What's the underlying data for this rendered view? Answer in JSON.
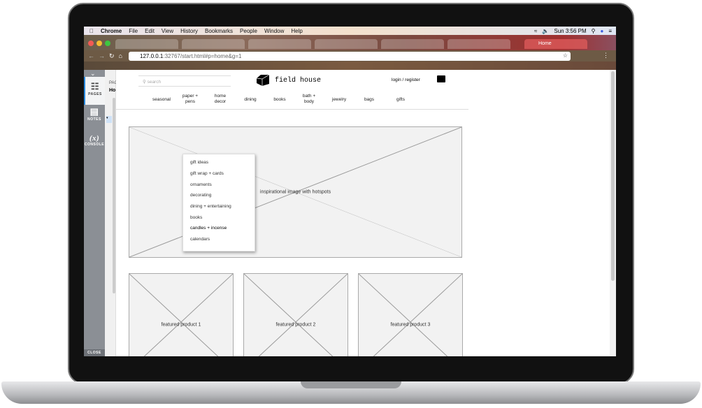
{
  "menubar": {
    "app": "Chrome",
    "items": [
      "File",
      "Edit",
      "View",
      "History",
      "Bookmarks",
      "People",
      "Window",
      "Help"
    ],
    "clock": "Sun 3:56 PM"
  },
  "browser": {
    "active_tab": "Home",
    "url_host": "127.0.0.1",
    "url_rest": ":32767/start.html#p=home&g=1"
  },
  "axure": {
    "pages": "PAGES",
    "notes": "NOTES",
    "console": "CONSOLE",
    "console_icon": "(x)",
    "close": "CLOSE",
    "panel_label": "PAG",
    "panel_page": "Ho"
  },
  "site": {
    "search_placeholder": "search",
    "brand": "field house",
    "login": "login / register",
    "nav": [
      "seasonal",
      "paper +\npens",
      "home\ndecor",
      "dining",
      "books",
      "bath +\nbody",
      "jewelry",
      "bags",
      "gifts"
    ],
    "dropdown": [
      "gift ideas",
      "gift wrap + cards",
      "ornaments",
      "decorating",
      "dining + entertaining",
      "books",
      "candles + incense",
      "calendars"
    ],
    "hero": "inspirational image with hotspots",
    "products": [
      "featured product 1",
      "featured product 2",
      "featured product 3"
    ]
  }
}
